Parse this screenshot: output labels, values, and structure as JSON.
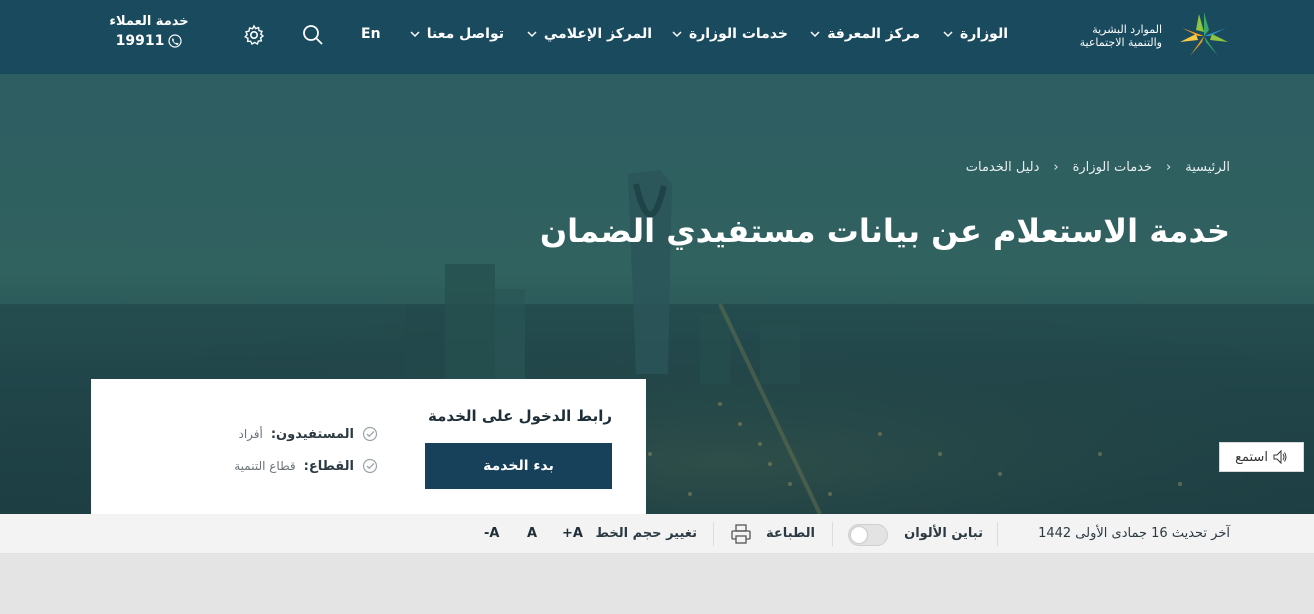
{
  "header": {
    "logo_line1": "الموارد البشرية",
    "logo_line2": "والتنمية الاجتماعية",
    "nav": [
      {
        "label": "الوزارة"
      },
      {
        "label": "مركز المعرفة"
      },
      {
        "label": "خدمات الوزارة"
      },
      {
        "label": "المركز الإعلامي"
      },
      {
        "label": "تواصل معنا"
      }
    ],
    "lang": "En",
    "customer_service_label": "خدمة العملاء",
    "customer_service_number": "19911"
  },
  "breadcrumb": [
    "الرئيسية",
    "خدمات الوزارة",
    "دليل الخدمات"
  ],
  "page_title": "خدمة الاستعلام عن بيانات مستفيدي الضمان",
  "service_card": {
    "title": "رابط الدخول على الخدمة",
    "start_button": "بدء الخدمة",
    "beneficiaries_label": "المستفيدون:",
    "beneficiaries_value": "أفراد",
    "sector_label": "القطاع:",
    "sector_value": "قطاع التنمية"
  },
  "listen_label": "استمع",
  "toolbar": {
    "last_update": "آخر تحديث 16 جمادى الأولى 1442",
    "contrast_label": "تباين الألوان",
    "contrast_on": false,
    "print_label": "الطباعة",
    "font_size_label": "تغيير حجم الخط",
    "font_plus": "+A",
    "font_normal": "A",
    "font_minus": "-A"
  },
  "colors": {
    "header_bg": "#1a4a5e",
    "button_bg": "#17405a",
    "logo_green": "#3aa66a",
    "logo_orange": "#f2a01e"
  }
}
